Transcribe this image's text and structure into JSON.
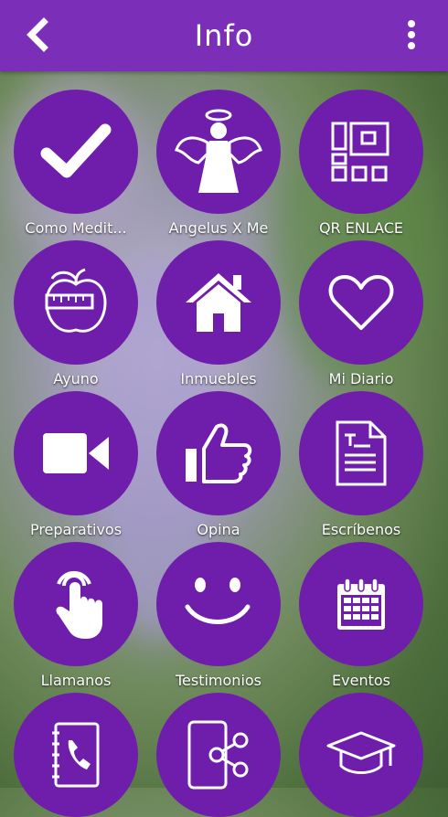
{
  "header": {
    "title": "Info",
    "back_icon": "chevron-left-icon",
    "menu_icon": "more-vertical-icon",
    "color": "#7b2fb8"
  },
  "tiles": [
    {
      "label": "Como Medit...",
      "icon": "checkmark-icon"
    },
    {
      "label": "Angelus X Me",
      "icon": "angel-icon"
    },
    {
      "label": "QR ENLACE",
      "icon": "qr-code-icon"
    },
    {
      "label": "Ayuno",
      "icon": "apple-measure-icon"
    },
    {
      "label": "Inmuebles",
      "icon": "home-icon"
    },
    {
      "label": "Mi Diario",
      "icon": "heart-icon"
    },
    {
      "label": "Preparativos",
      "icon": "video-camera-icon"
    },
    {
      "label": "Opina",
      "icon": "thumbs-up-icon"
    },
    {
      "label": "Escríbenos",
      "icon": "document-icon"
    },
    {
      "label": "Llamanos",
      "icon": "touch-hand-icon"
    },
    {
      "label": "Testimonios",
      "icon": "smiley-icon"
    },
    {
      "label": "Eventos",
      "icon": "calendar-icon"
    },
    {
      "label": "",
      "icon": "phonebook-icon"
    },
    {
      "label": "",
      "icon": "share-phone-icon"
    },
    {
      "label": "",
      "icon": "graduation-cap-icon"
    }
  ],
  "tile_color": "#6f1eab"
}
